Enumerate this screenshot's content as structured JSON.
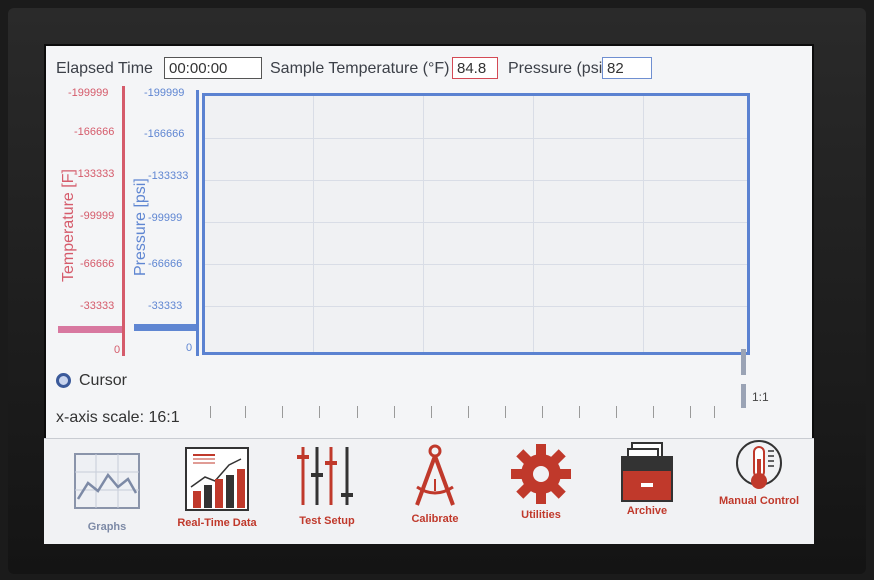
{
  "header": {
    "elapsed_label": "Elapsed Time",
    "elapsed_value": "00:00:00",
    "temp_label": "Sample Temperature (°F)",
    "temp_value": "84.8",
    "pressure_label": "Pressure (psi)",
    "pressure_value": "82"
  },
  "axes": {
    "temperature_title": "Temperature [F]",
    "pressure_title": "Pressure [psi]",
    "temperature_ticks": [
      "-199999",
      "-166666",
      "-133333",
      "-99999",
      "-66666",
      "-33333",
      "0"
    ],
    "pressure_ticks": [
      "-199999",
      "-166666",
      "-133333",
      "-99999",
      "-66666",
      "-33333",
      "0"
    ]
  },
  "cursor_label": "Cursor",
  "x_axis_scale_label": "x-axis scale: 16:1",
  "ratio_label": "1:1",
  "nav": [
    {
      "label": "Graphs",
      "icon": "graphs-icon"
    },
    {
      "label": "Real-Time Data",
      "icon": "bar-chart-icon"
    },
    {
      "label": "Test Setup",
      "icon": "sliders-icon"
    },
    {
      "label": "Calibrate",
      "icon": "compass-icon"
    },
    {
      "label": "Utilities",
      "icon": "gear-icon"
    },
    {
      "label": "Archive",
      "icon": "archive-icon"
    },
    {
      "label": "Manual Control",
      "icon": "thermometer-icon"
    }
  ],
  "colors": {
    "temperature": "#d55b6b",
    "pressure": "#5f86d2",
    "nav_accent": "#c0392b",
    "nav_muted": "#7d8aa6"
  }
}
